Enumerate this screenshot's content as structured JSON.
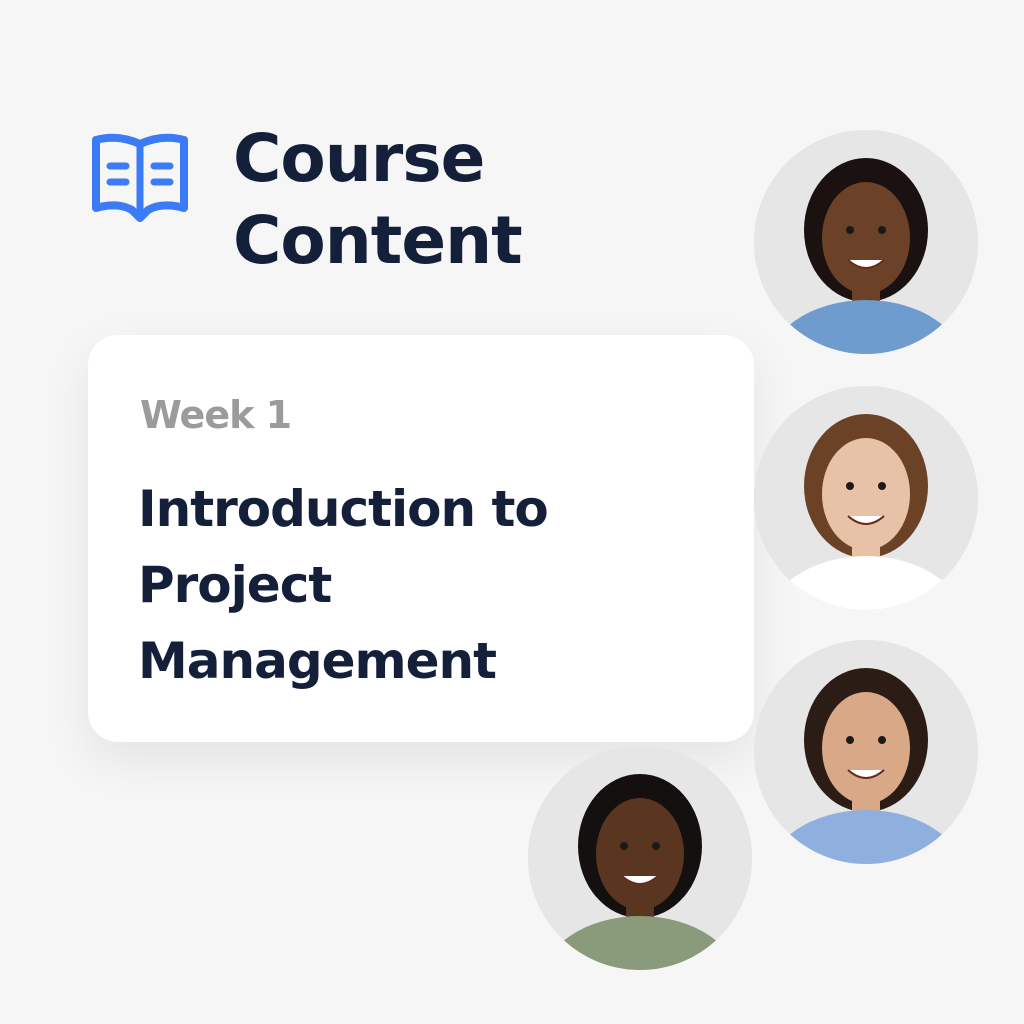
{
  "header": {
    "icon": "open-book-icon",
    "title_line1": "Course",
    "title_line2": "Content",
    "accent_color": "#3b7cf6"
  },
  "card": {
    "week_label": "Week 1",
    "lesson_title": "Introduction to Project Management"
  },
  "avatars": [
    {
      "skin": "#6b4228",
      "hair": "#1a1110",
      "shirt": "#6f9ccf"
    },
    {
      "skin": "#e8c2a6",
      "hair": "#6b4226",
      "shirt": "#ffffff"
    },
    {
      "skin": "#d9a887",
      "hair": "#2b1d16",
      "shirt": "#8fb0de"
    },
    {
      "skin": "#5a3620",
      "hair": "#151010",
      "shirt": "#8a9b7c"
    }
  ]
}
